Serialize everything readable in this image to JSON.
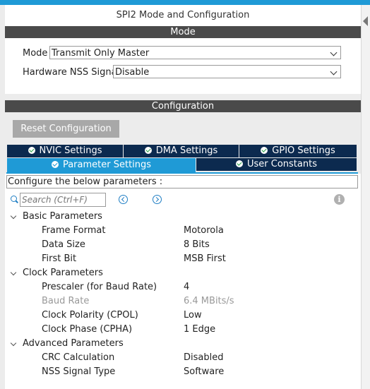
{
  "window": {
    "title": "SPI2 Mode and Configuration"
  },
  "mode_section": {
    "header": "Mode",
    "mode_label": "Mode",
    "mode_value": "Transmit Only Master",
    "nss_label": "Hardware NSS Signal",
    "nss_value": "Disable"
  },
  "config_section": {
    "header": "Configuration",
    "reset_label": "Reset Configuration",
    "tabs_row1": [
      "NVIC Settings",
      "DMA Settings",
      "GPIO Settings"
    ],
    "tabs_row2": [
      "Parameter Settings",
      "User Constants"
    ],
    "active_tab": "Parameter Settings",
    "configure_text": "Configure the below parameters :",
    "search_placeholder": "Search (Ctrl+F)",
    "info_glyph": "i"
  },
  "parameters": {
    "groups": [
      {
        "name": "Basic Parameters",
        "items": [
          {
            "name": "Frame Format",
            "value": "Motorola"
          },
          {
            "name": "Data Size",
            "value": "8 Bits"
          },
          {
            "name": "First Bit",
            "value": "MSB First"
          }
        ]
      },
      {
        "name": "Clock Parameters",
        "items": [
          {
            "name": "Prescaler (for Baud Rate)",
            "value": "4"
          },
          {
            "name": "Baud Rate",
            "value": "6.4 MBits/s",
            "disabled": true
          },
          {
            "name": "Clock Polarity (CPOL)",
            "value": "Low"
          },
          {
            "name": "Clock Phase (CPHA)",
            "value": "1 Edge"
          }
        ]
      },
      {
        "name": "Advanced Parameters",
        "items": [
          {
            "name": "CRC Calculation",
            "value": "Disabled"
          },
          {
            "name": "NSS Signal Type",
            "value": "Software"
          }
        ]
      }
    ]
  },
  "colors": {
    "accent": "#1f9ad6",
    "tab_dark": "#0c2a4f",
    "section_header": "#4a4a4a"
  }
}
